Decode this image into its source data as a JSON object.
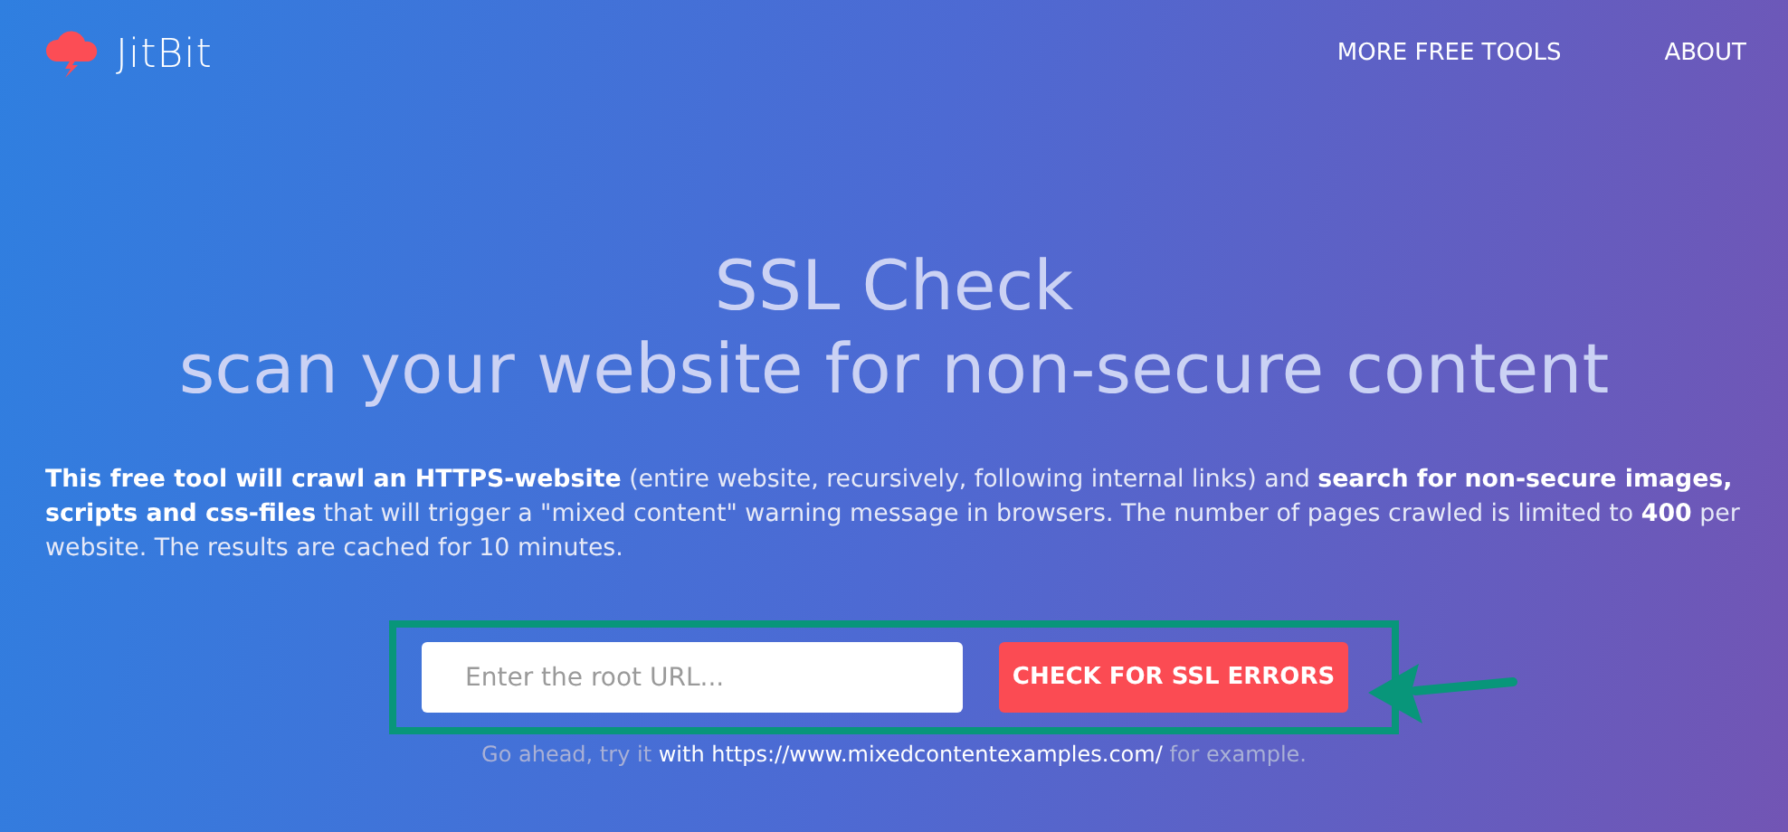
{
  "navbar": {
    "brand": "JitBit",
    "links": [
      "MORE FREE TOOLS",
      "ABOUT"
    ]
  },
  "hero": {
    "title": "SSL Check",
    "subtitle": "scan your website for non-secure content"
  },
  "description": "**This free tool will crawl an HTTPS-website** (entire website, recursively, following internal links) and **search for non-secure images, scripts and css-files** that will trigger a \"mixed content\" warning message in browsers. The number of pages crawled is limited to **400** per website. The results are cached for 10 minutes.",
  "form": {
    "url_field": {
      "placeholder": "Enter the root URL..."
    },
    "button": "CHECK FOR SSL ERRORS"
  },
  "hint": {
    "before": "Go ahead, try it ",
    "link": "with https://www.mixedcontentexamples.com/",
    "after": " for example."
  }
}
